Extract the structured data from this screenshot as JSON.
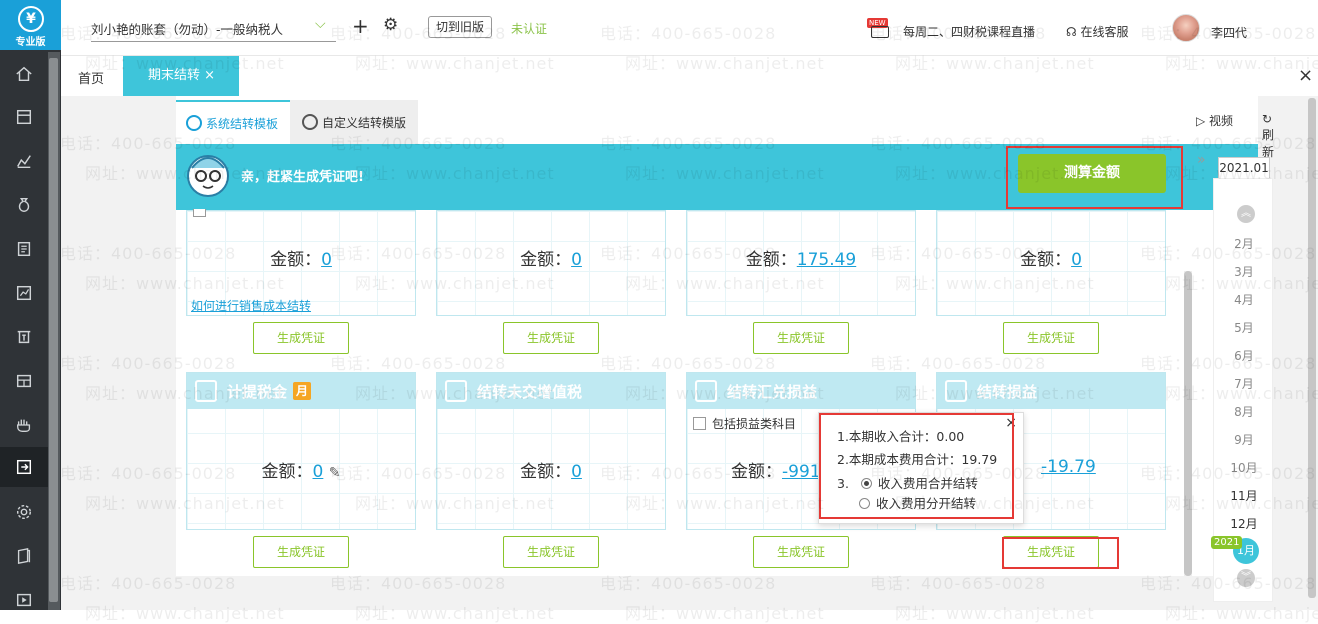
{
  "logo": {
    "label": "专业版"
  },
  "topbar": {
    "company": "刘小艳的账套（勿动）-一般纳税人",
    "switch_old": "切到旧版",
    "unverified": "未认证",
    "live_badge": "NEW",
    "live_text": "每周二、四财税课程直播",
    "support": "在线客服",
    "user_name": "李四代"
  },
  "tabs": {
    "home": "首页",
    "active": "期末结转",
    "active_close": "×",
    "close_all": "×"
  },
  "subtabs": {
    "system": "系统结转模板",
    "custom": "自定义结转模版",
    "video": "视频",
    "refresh": "刷新"
  },
  "banner": {
    "message": "亲，赶紧生成凭证吧!",
    "calc_button": "测算金额"
  },
  "cards_top": [
    {
      "amount_label": "金额：",
      "amount": "0",
      "link": "如何进行销售成本结转"
    },
    {
      "amount_label": "金额：",
      "amount": "0"
    },
    {
      "amount_label": "金额：",
      "amount": "175.49"
    },
    {
      "amount_label": "金额：",
      "amount": "0"
    }
  ],
  "cards_bottom": [
    {
      "title": "计提税金",
      "tag": "月",
      "amount_label": "金额：",
      "amount": "0"
    },
    {
      "title": "结转未交增值税",
      "amount_label": "金额：",
      "amount": "0"
    },
    {
      "title": "结转汇兑损益",
      "checkbox": "包括损益类科目",
      "amount_label": "金额：",
      "amount": "-991"
    },
    {
      "title": "结转损益",
      "amount": "-19.79"
    }
  ],
  "generate_label": "生成凭证",
  "popup": {
    "line1": "1.本期收入合计：0.00",
    "line2": "2.本期成本费用合计：19.79",
    "line3": "3.",
    "opt1": "收入费用合并结转",
    "opt2": "收入费用分开结转",
    "close": "×"
  },
  "calendar": {
    "year_selected": "2021.01",
    "months": [
      "2月",
      "3月",
      "4月",
      "5月",
      "6月",
      "7月",
      "8月",
      "9月",
      "10月",
      "11月",
      "12月"
    ],
    "current_year": "2021",
    "current_month": "1月"
  },
  "watermark": {
    "phone": "电话：400-665-0028",
    "site": "网址：www.chanjet.net"
  },
  "colors": {
    "accent": "#3ec5da",
    "green": "#8ac52a",
    "highlight": "#e53935",
    "sidebar": "#2f3337"
  }
}
